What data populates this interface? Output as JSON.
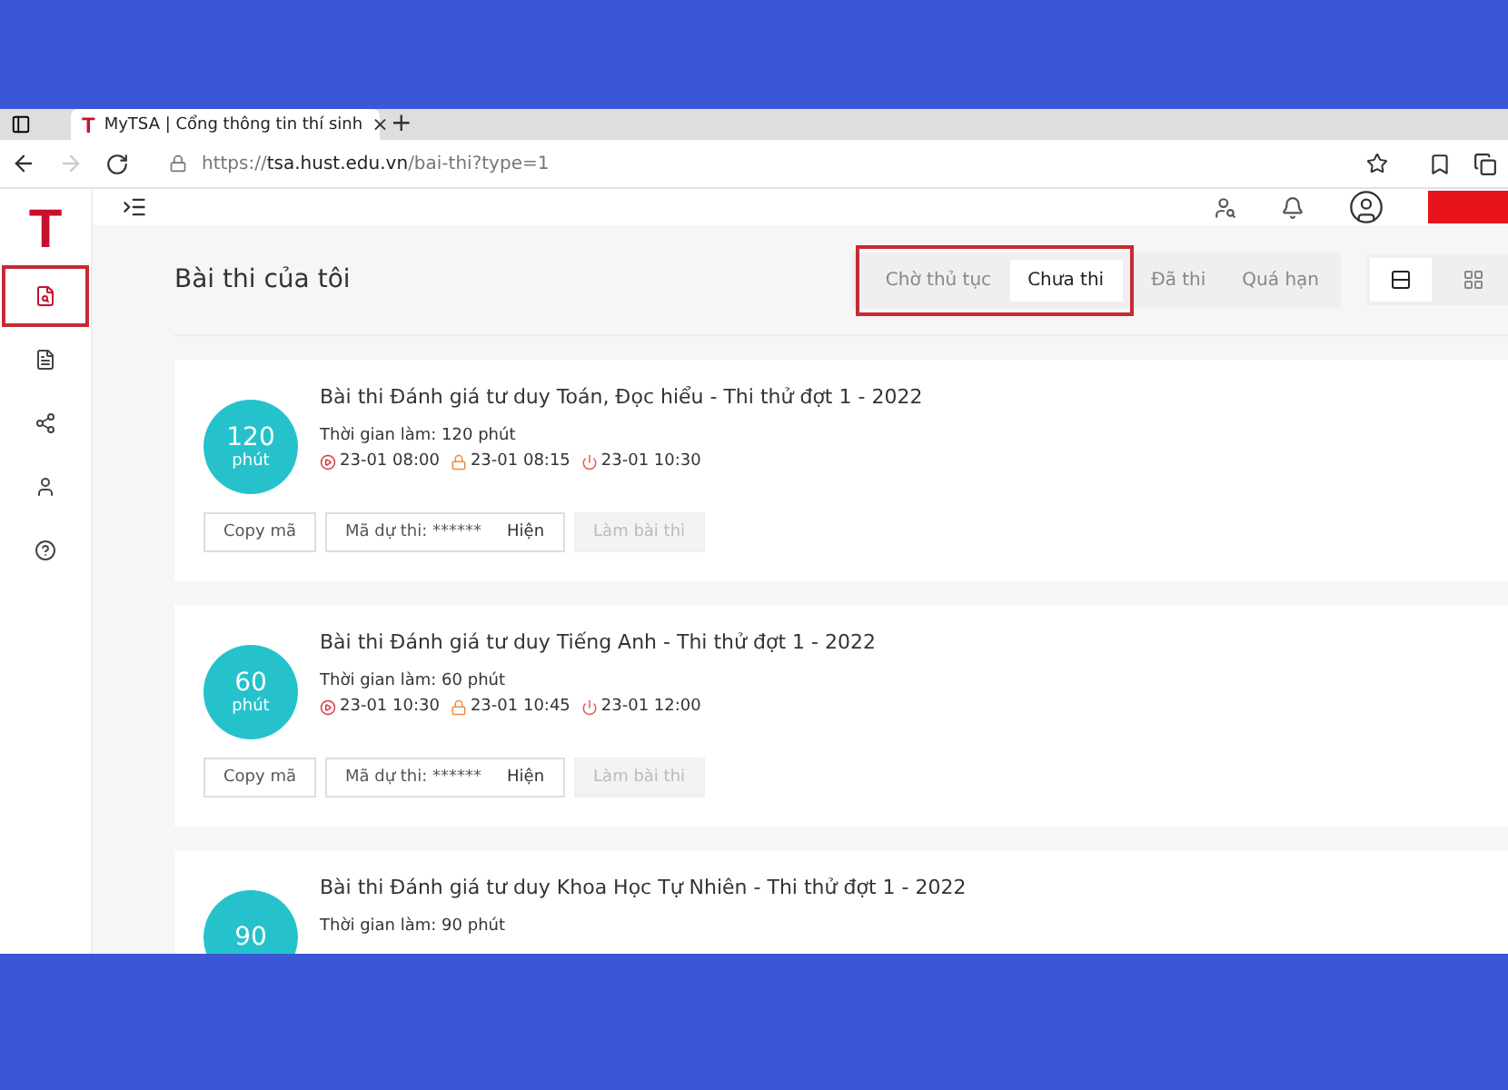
{
  "browser": {
    "tab": {
      "logo": "T",
      "title": "MyTSA | Cổng thông tin thí sinh",
      "close": "×",
      "new_tab": "+"
    },
    "address": {
      "scheme": "https://",
      "host": "tsa.hust.edu.vn",
      "path": "/bai-thi?type=1"
    },
    "forward_disabled": true
  },
  "sidebar": {
    "logo": "T",
    "items": [
      {
        "kind": "exams",
        "selected": true
      },
      {
        "kind": "document",
        "selected": false
      },
      {
        "kind": "share",
        "selected": false
      },
      {
        "kind": "profile",
        "selected": false
      },
      {
        "kind": "help",
        "selected": false
      }
    ]
  },
  "header": {
    "user_redacted": true
  },
  "page": {
    "title": "Bài thi của tôi",
    "tabs": [
      {
        "label": "Chờ thủ tục",
        "selected": false,
        "highlighted": true
      },
      {
        "label": "Chưa thi",
        "selected": true,
        "highlighted": true
      },
      {
        "label": "Đã thi",
        "selected": false,
        "highlighted": false
      },
      {
        "label": "Quá hạn",
        "selected": false,
        "highlighted": false
      }
    ],
    "views": [
      {
        "kind": "list",
        "selected": true
      },
      {
        "kind": "grid",
        "selected": false
      }
    ]
  },
  "exams": [
    {
      "duration": "120",
      "unit": "phút",
      "title": "Bài thi Đánh giá tư duy Toán, Đọc hiểu - Thi thử đợt 1 - 2022",
      "time_text": "Thời gian làm: 120 phút",
      "times": [
        {
          "kind": "start",
          "text": "23-01 08:00"
        },
        {
          "kind": "lock",
          "text": "23-01 08:15"
        },
        {
          "kind": "end",
          "text": "23-01 10:30"
        }
      ],
      "copy": "Copy mã",
      "code": "Mã dự thi: ******",
      "reveal": "Hiện",
      "action": "Làm bài thi",
      "action_disabled": true
    },
    {
      "duration": "60",
      "unit": "phút",
      "title": "Bài thi Đánh giá tư duy Tiếng Anh - Thi thử đợt 1 - 2022",
      "time_text": "Thời gian làm: 60 phút",
      "times": [
        {
          "kind": "start",
          "text": "23-01 10:30"
        },
        {
          "kind": "lock",
          "text": "23-01 10:45"
        },
        {
          "kind": "end",
          "text": "23-01 12:00"
        }
      ],
      "copy": "Copy mã",
      "code": "Mã dự thi: ******",
      "reveal": "Hiện",
      "action": "Làm bài thi",
      "action_disabled": true
    },
    {
      "duration": "90",
      "title": "Bài thi Đánh giá tư duy Khoa Học Tự Nhiên - Thi thử đợt 1 - 2022",
      "time_text": "Thời gian làm: 90 phút"
    }
  ]
}
